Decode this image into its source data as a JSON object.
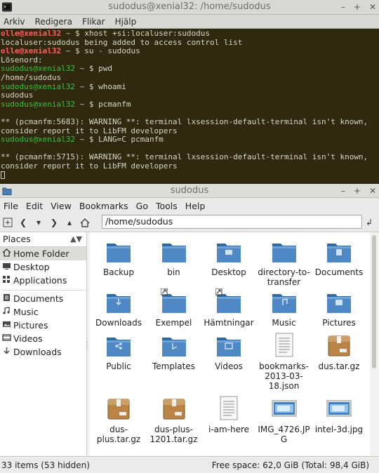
{
  "terminal": {
    "title": "sudodus@xenial32: /home/sudodus",
    "menu": [
      "Arkiv",
      "Redigera",
      "Flikar",
      "Hjälp"
    ],
    "lines": [
      {
        "t": "prompt",
        "user": "olle@xenial32",
        "path": "~",
        "cmd": "xhost +si:localuser:sudodus"
      },
      {
        "t": "out",
        "text": "localuser:sudodus being added to access control list"
      },
      {
        "t": "prompt",
        "user": "olle@xenial32",
        "path": "~",
        "cmd": "su - sudodus"
      },
      {
        "t": "out",
        "text": "Lösenord:"
      },
      {
        "t": "prompt",
        "user": "sudodus@xenial32",
        "path": "~",
        "cmd": "pwd"
      },
      {
        "t": "out",
        "text": "/home/sudodus"
      },
      {
        "t": "prompt",
        "user": "sudodus@xenial32",
        "path": "~",
        "cmd": "whoami"
      },
      {
        "t": "out",
        "text": "sudodus"
      },
      {
        "t": "prompt",
        "user": "sudodus@xenial32",
        "path": "~",
        "cmd": "pcmanfm"
      },
      {
        "t": "out",
        "text": ""
      },
      {
        "t": "out",
        "text": "** (pcmanfm:5683): WARNING **: terminal lxsession-default-terminal isn't known,"
      },
      {
        "t": "out",
        "text": "consider report it to LibFM developers"
      },
      {
        "t": "prompt",
        "user": "sudodus@xenial32",
        "path": "~",
        "cmd": "LANG=C pcmanfm"
      },
      {
        "t": "out",
        "text": ""
      },
      {
        "t": "out",
        "text": "** (pcmanfm:5715): WARNING **: terminal lxsession-default-terminal isn't known,"
      },
      {
        "t": "out",
        "text": "consider report it to LibFM developers"
      },
      {
        "t": "cursor",
        "text": ""
      }
    ]
  },
  "filemanager": {
    "title": "sudodus",
    "menu": [
      "File",
      "Edit",
      "View",
      "Bookmarks",
      "Go",
      "Tools",
      "Help"
    ],
    "path": "/home/sudodus",
    "places_header": "Places",
    "places": [
      {
        "label": "Home Folder",
        "icon": "home-icon",
        "selected": true
      },
      {
        "label": "Desktop",
        "icon": "desktop-icon"
      },
      {
        "label": "Applications",
        "icon": "applications-icon"
      }
    ],
    "bookmarks": [
      {
        "label": "Documents",
        "icon": "documents-icon"
      },
      {
        "label": "Music",
        "icon": "music-icon"
      },
      {
        "label": "Pictures",
        "icon": "pictures-icon"
      },
      {
        "label": "Videos",
        "icon": "videos-icon"
      },
      {
        "label": "Downloads",
        "icon": "downloads-icon"
      }
    ],
    "items": [
      {
        "label": "Backup",
        "kind": "folder"
      },
      {
        "label": "bin",
        "kind": "folder"
      },
      {
        "label": "Desktop",
        "kind": "folder-desktop"
      },
      {
        "label": "directory-to-transfer",
        "kind": "folder"
      },
      {
        "label": "Documents",
        "kind": "folder-documents"
      },
      {
        "label": "Downloads",
        "kind": "folder-downloads"
      },
      {
        "label": "Exempel",
        "kind": "folder-link"
      },
      {
        "label": "Hämtningar",
        "kind": "folder-link"
      },
      {
        "label": "Music",
        "kind": "folder-music"
      },
      {
        "label": "Pictures",
        "kind": "folder-pictures"
      },
      {
        "label": "Public",
        "kind": "folder-public"
      },
      {
        "label": "Templates",
        "kind": "folder-templates"
      },
      {
        "label": "Videos",
        "kind": "folder-videos"
      },
      {
        "label": "bookmarks-2013-03-18.json",
        "kind": "text"
      },
      {
        "label": "dus.tar.gz",
        "kind": "archive"
      },
      {
        "label": "dus-plus.tar.gz",
        "kind": "archive"
      },
      {
        "label": "dus-plus-1201.tar.gz",
        "kind": "archive"
      },
      {
        "label": "i-am-here",
        "kind": "text"
      },
      {
        "label": "IMG_4726.JPG",
        "kind": "image"
      },
      {
        "label": "intel-3d.jpg",
        "kind": "image"
      }
    ],
    "status_left": "33 items (53 hidden)",
    "status_right": "Free space: 62,0 GiB (Total: 98,4 GiB)"
  }
}
